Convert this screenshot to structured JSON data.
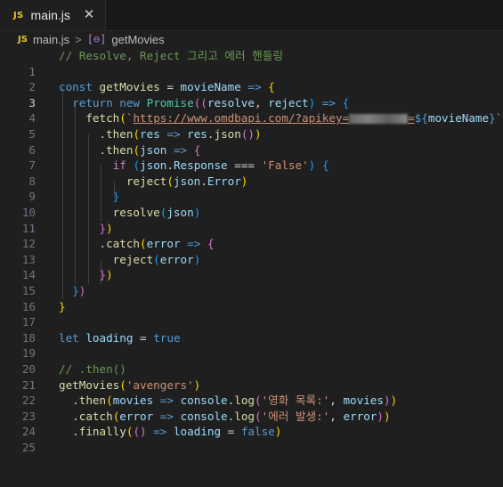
{
  "tab": {
    "badge": "JS",
    "title": "main.js",
    "close": "✕"
  },
  "breadcrumb": {
    "badge": "JS",
    "file": "main.js",
    "separator": ">",
    "symbol_icon": "[⊖]",
    "symbol": "getMovies"
  },
  "line_numbers": [
    "1",
    "2",
    "3",
    "4",
    "5",
    "6",
    "7",
    "8",
    "9",
    "10",
    "11",
    "12",
    "13",
    "14",
    "15",
    "16",
    "17",
    "18",
    "19",
    "20",
    "21",
    "22",
    "23",
    "24",
    "25"
  ],
  "active_line": "3",
  "code": {
    "l1": {
      "comment": "// Resolve, Reject 그리고 에러 핸들링"
    },
    "l3": {
      "kw": "const",
      "name": "getMovies",
      "eq": "=",
      "param": "movieName",
      "arrow": "=>",
      "brace": "{"
    },
    "l4": {
      "ret": "return",
      "new": "new",
      "cls": "Promise",
      "p1": "((",
      "a": "resolve",
      "comma": ",",
      "b": "reject",
      "p2": ")",
      "arrow": "=>",
      "brace": "{"
    },
    "l5": {
      "fn": "fetch",
      "open": "(",
      "tick": "`",
      "url_a": "https://www.omdbapi.com/?apikey=",
      "url_b": "=",
      "interp_open": "${",
      "interp_var": "movieName",
      "interp_close": "}",
      "tick2": "`",
      "close": ")"
    },
    "l6": {
      "dot": ".",
      "fn": "then",
      "open": "(",
      "p": "res",
      "arrow": "=>",
      "obj": "res",
      "dot2": ".",
      "m": "json",
      "call": "()",
      "close": ")"
    },
    "l7": {
      "dot": ".",
      "fn": "then",
      "open": "(",
      "p": "json",
      "arrow": "=>",
      "brace": "{"
    },
    "l8": {
      "kw": "if",
      "open": "(",
      "obj": "json",
      "dot": ".",
      "prop": "Response",
      "op": "===",
      "str": "'False'",
      "close": ")",
      "brace": "{"
    },
    "l9": {
      "fn": "reject",
      "open": "(",
      "obj": "json",
      "dot": ".",
      "prop": "Error",
      "close": ")"
    },
    "l10": {
      "brace": "}"
    },
    "l11": {
      "fn": "resolve",
      "open": "(",
      "arg": "json",
      "close": ")"
    },
    "l12": {
      "brace": "}",
      "paren": ")"
    },
    "l13": {
      "dot": ".",
      "fn": "catch",
      "open": "(",
      "p": "error",
      "arrow": "=>",
      "brace": "{"
    },
    "l14": {
      "fn": "reject",
      "open": "(",
      "arg": "error",
      "close": ")"
    },
    "l15": {
      "brace": "}",
      "paren": ")"
    },
    "l16": {
      "brace": "}",
      "paren": ")"
    },
    "l17": {
      "brace": "}"
    },
    "l19": {
      "kw": "let",
      "name": "loading",
      "eq": "=",
      "val": "true"
    },
    "l21": {
      "comment": "// .then()"
    },
    "l22": {
      "fn": "getMovies",
      "open": "(",
      "str": "'avengers'",
      "close": ")"
    },
    "l23": {
      "dot": ".",
      "fn": "then",
      "open": "(",
      "p": "movies",
      "arrow": "=>",
      "obj": "console",
      "dot2": ".",
      "m": "log",
      "open2": "(",
      "str": "'영화 목록:'",
      "comma": ",",
      "arg": "movies",
      "close2": ")",
      "close": ")"
    },
    "l24": {
      "dot": ".",
      "fn": "catch",
      "open": "(",
      "p": "error",
      "arrow": "=>",
      "obj": "console",
      "dot2": ".",
      "m": "log",
      "open2": "(",
      "str": "'에러 발생:'",
      "comma": ",",
      "arg": "error",
      "close2": ")",
      "close": ")"
    },
    "l25": {
      "dot": ".",
      "fn": "finally",
      "open": "(",
      "params": "()",
      "arrow": "=>",
      "name": "loading",
      "eq": "=",
      "val": "false",
      "close": ")"
    }
  },
  "colors": {
    "background": "#1f1f1f",
    "comment": "#6a9955",
    "keyword": "#569cd6",
    "function": "#dcdcaa",
    "variable": "#9cdcfe",
    "string": "#ce9178",
    "bracket1": "#ffd700",
    "bracket2": "#da70d6",
    "bracket3": "#179fff"
  },
  "icons": {
    "tab_badge": "js-file-icon",
    "close": "close-icon",
    "symbol": "symbol-method-icon"
  }
}
